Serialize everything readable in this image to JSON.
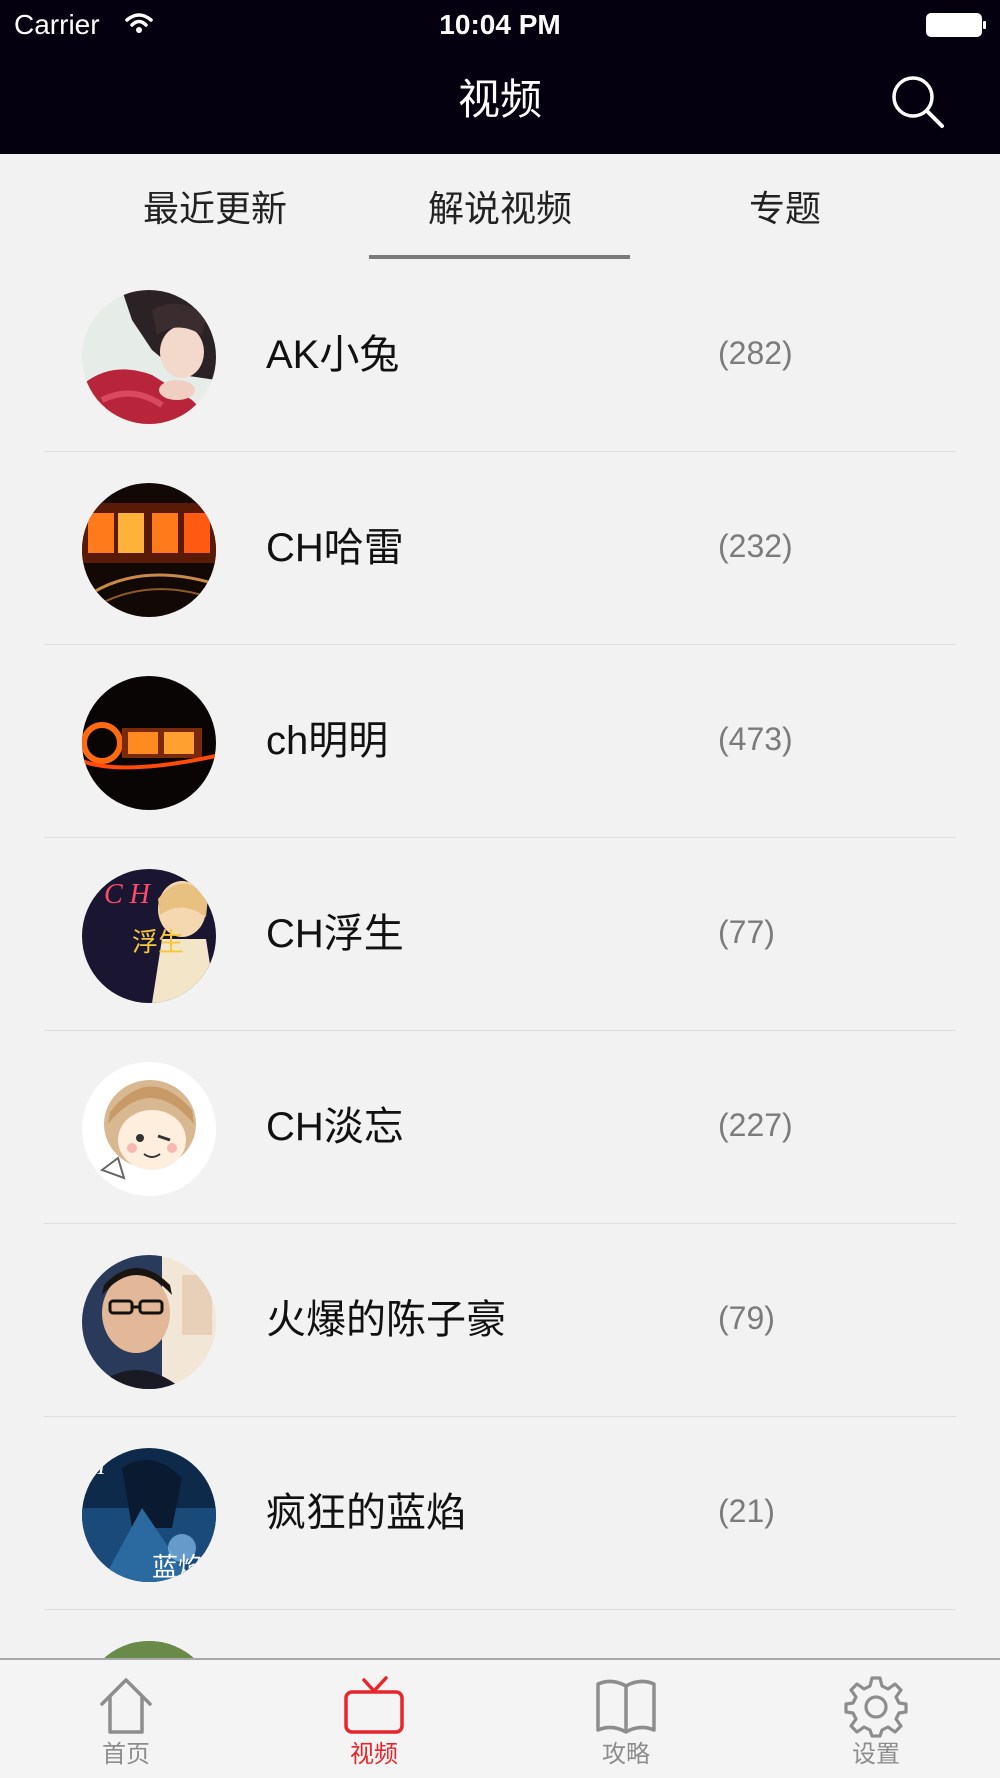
{
  "status_bar": {
    "carrier": "Carrier",
    "time": "10:04 PM"
  },
  "nav": {
    "title": "视频",
    "search_icon": "search-icon"
  },
  "tabs": [
    {
      "label": "最近更新",
      "active": false
    },
    {
      "label": "解说视频",
      "active": true
    },
    {
      "label": "专题",
      "active": false
    }
  ],
  "list": [
    {
      "name": "AK小兔",
      "count": "(282)",
      "avatar": "photo-girl-red-sweater"
    },
    {
      "name": "CH哈雷",
      "count": "(232)",
      "avatar": "fire-text-logo"
    },
    {
      "name": "ch明明",
      "count": "(473)",
      "avatar": "fire-logo-dark"
    },
    {
      "name": "CH浮生",
      "count": "(77)",
      "avatar": "anime-boy-dark"
    },
    {
      "name": "CH淡忘",
      "count": "(227)",
      "avatar": "cartoon-boy-wink"
    },
    {
      "name": "火爆的陈子豪",
      "count": "(79)",
      "avatar": "photo-boy-glasses"
    },
    {
      "name": "疯狂的蓝焰",
      "count": "(21)",
      "avatar": "blue-anime-art"
    }
  ],
  "tab_bar": [
    {
      "label": "首页",
      "icon": "home-icon",
      "active": false
    },
    {
      "label": "视频",
      "icon": "tv-icon",
      "active": true
    },
    {
      "label": "攻略",
      "icon": "book-icon",
      "active": false
    },
    {
      "label": "设置",
      "icon": "gear-icon",
      "active": false
    }
  ],
  "colors": {
    "header_bg": "#05000f",
    "page_bg": "#f2f2f2",
    "accent": "#e8252a",
    "count_text": "#7b7b7b"
  }
}
